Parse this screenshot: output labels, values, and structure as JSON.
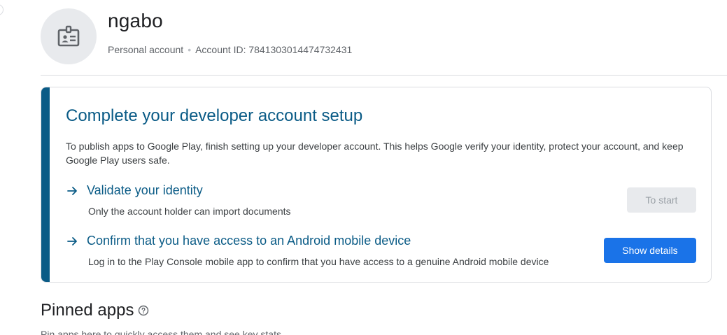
{
  "account": {
    "name": "ngabo",
    "type": "Personal account",
    "separator": "•",
    "id_label": "Account ID: 7841303014474732431",
    "avatar_icon": "id-badge-icon"
  },
  "setup_card": {
    "accent_color": "#0a5b86",
    "title": "Complete your developer account setup",
    "description": "To publish apps to Google Play, finish setting up your developer account. This helps Google verify your identity, protect your account, and keep Google Play users safe.",
    "steps": [
      {
        "icon": "arrow-right-icon",
        "title": "Validate your identity",
        "subtitle": "Only the account holder can import documents",
        "button_label": "To start",
        "button_state": "disabled"
      },
      {
        "icon": "arrow-right-icon",
        "title": "Confirm that you have access to an Android mobile device",
        "subtitle": "Log in to the Play Console mobile app to confirm that you have access to a genuine Android mobile device",
        "button_label": "Show details",
        "button_state": "primary",
        "button_color": "#1a73e8"
      }
    ]
  },
  "pinned": {
    "title": "Pinned apps",
    "help_icon": "help-circle-icon",
    "description": "Pin apps here to quickly access them and see key stats"
  }
}
